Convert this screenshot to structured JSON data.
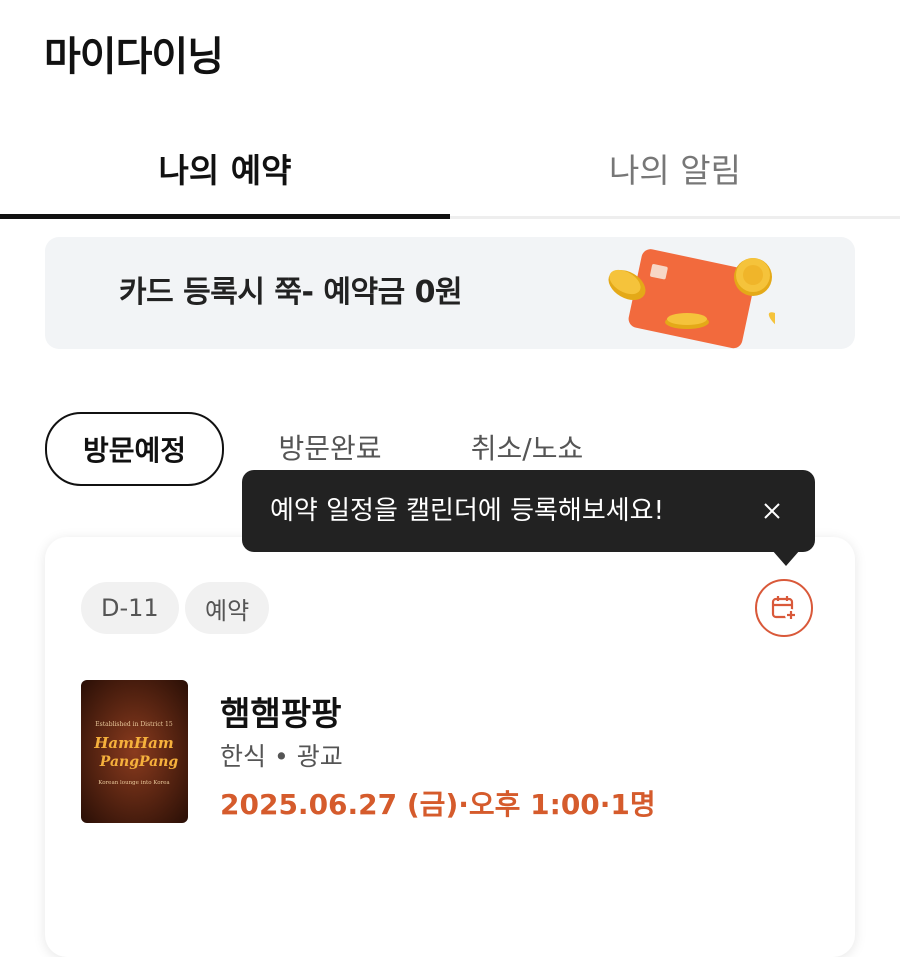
{
  "header": {
    "title": "마이다이닝"
  },
  "tabs": [
    {
      "label": "나의 예약",
      "active": true
    },
    {
      "label": "나의 알림",
      "active": false
    }
  ],
  "banner": {
    "text": "카드 등록시 쭉- 예약금 0원",
    "icon": "credit-card-with-coins"
  },
  "filters": [
    {
      "label": "방문예정",
      "selected": true
    },
    {
      "label": "방문완료",
      "selected": false
    },
    {
      "label": "취소/노쇼",
      "selected": false
    }
  ],
  "tooltip": {
    "text": "예약 일정을 캘린더에 등록해보세요!",
    "close_icon": "close-icon"
  },
  "reservation": {
    "dday": "D-11",
    "status": "예약",
    "calendar_icon": "calendar-add-icon",
    "restaurant_name": "햄햄팡팡",
    "category": "한식",
    "location": "광교",
    "datetime": "2025.06.27 (금)·오후 1:00·1명",
    "thumbnail": {
      "top_text": "Established in District 15",
      "line1": "HamHam",
      "line2": "PangPang",
      "bottom_text": "Korean lounge into Korea"
    }
  },
  "colors": {
    "accent": "#d55b2c",
    "tooltip_bg": "#222222",
    "banner_bg": "#f2f4f6",
    "card_orange": "#f26a3d",
    "coin_gold": "#f5c33b"
  }
}
